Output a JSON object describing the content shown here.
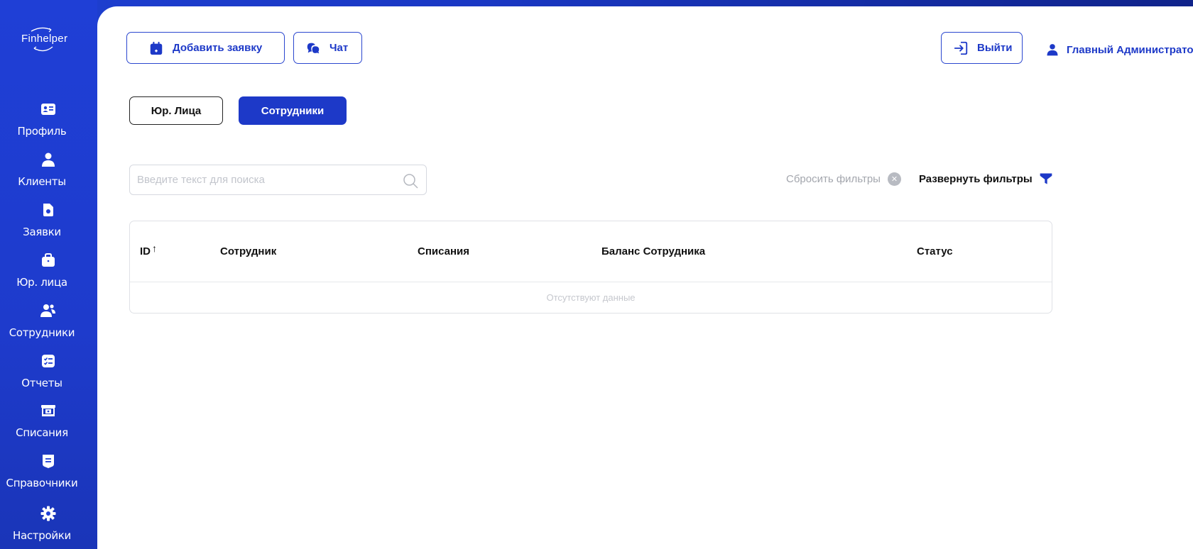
{
  "logo": {
    "text": "Finhelper"
  },
  "sidebar": {
    "items": [
      {
        "label": "Профиль",
        "icon": "id-card-icon"
      },
      {
        "label": "Клиенты",
        "icon": "user-icon"
      },
      {
        "label": "Заявки",
        "icon": "document-icon"
      },
      {
        "label": "Юр. лица",
        "icon": "briefcase-icon"
      },
      {
        "label": "Сотрудники",
        "icon": "users-icon"
      },
      {
        "label": "Отчеты",
        "icon": "checklist-icon"
      },
      {
        "label": "Списания",
        "icon": "cash-register-icon"
      },
      {
        "label": "Справочники",
        "icon": "handbook-icon"
      },
      {
        "label": "Настройки",
        "icon": "gear-icon"
      }
    ]
  },
  "header": {
    "add_request_label": "Добавить заявку",
    "chat_label": "Чат",
    "logout_label": "Выйти",
    "user_name": "Главный Администрато"
  },
  "tabs": [
    {
      "label": "Юр. Лица",
      "active": false
    },
    {
      "label": "Сотрудники",
      "active": true
    }
  ],
  "search": {
    "placeholder": "Введите текст для поиска",
    "value": ""
  },
  "filters": {
    "reset_label": "Сбросить фильтры",
    "expand_label": "Развернуть фильтры"
  },
  "table": {
    "columns": [
      "ID",
      "Сотрудник",
      "Списания",
      "Баланс Сотрудника",
      "Статус"
    ],
    "sort_column": "ID",
    "sort_direction": "asc",
    "rows": [],
    "empty_text": "Отсутствуют данные"
  },
  "colors": {
    "accent": "#1d39c8",
    "sidebar": "#1f3fd6",
    "muted": "#a3a6ad"
  }
}
